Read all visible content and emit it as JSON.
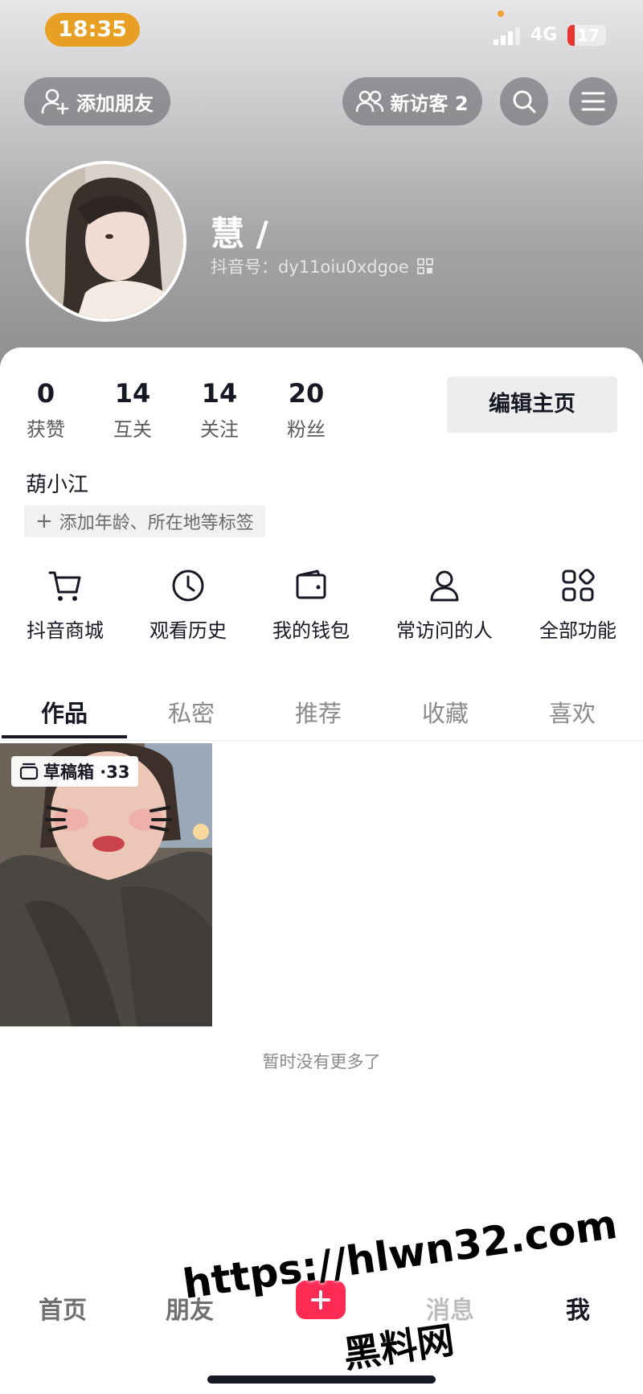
{
  "status_bar": {
    "time": "18:35",
    "network": "4G",
    "battery": "17"
  },
  "header": {
    "add_friend_label": "添加朋友",
    "new_visitors_label": "新访客 2",
    "search_icon": "search-icon",
    "menu_icon": "menu-icon"
  },
  "profile": {
    "nickname": "慧 /",
    "douyin_id": "抖音号：dy11oiu0xdgoe",
    "bio": "葫小江",
    "add_tags_label": "添加年龄、所在地等标签",
    "edit_profile_label": "编辑主页"
  },
  "stats": [
    {
      "value": "0",
      "label": "获赞"
    },
    {
      "value": "14",
      "label": "互关"
    },
    {
      "value": "14",
      "label": "关注"
    },
    {
      "value": "20",
      "label": "粉丝"
    }
  ],
  "tools": [
    {
      "label": "抖音商城",
      "icon": "cart-icon"
    },
    {
      "label": "观看历史",
      "icon": "clock-icon"
    },
    {
      "label": "我的钱包",
      "icon": "wallet-icon"
    },
    {
      "label": "常访问的人",
      "icon": "person-icon"
    },
    {
      "label": "全部功能",
      "icon": "grid-icon"
    }
  ],
  "tabs": [
    {
      "label": "作品",
      "active": true
    },
    {
      "label": "私密",
      "active": false
    },
    {
      "label": "推荐",
      "active": false
    },
    {
      "label": "收藏",
      "active": false
    },
    {
      "label": "喜欢",
      "active": false
    }
  ],
  "posts": {
    "draft_label": "草稿箱 ·33",
    "end_text": "暂时没有更多了"
  },
  "bottom_nav": {
    "home": "首页",
    "friends": "朋友",
    "messages": "消息",
    "me": "我"
  },
  "watermark": {
    "url": "https://hlwn32.com",
    "site": "黑料网"
  },
  "colors": {
    "accent": "#fe2c55",
    "time_pill": "#e8a024"
  }
}
